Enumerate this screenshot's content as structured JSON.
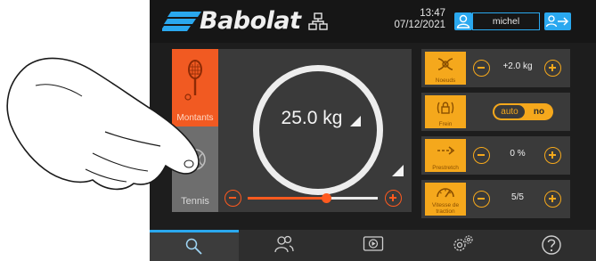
{
  "header": {
    "brand": "Babolat",
    "time": "13:47",
    "date": "07/12/2021",
    "user_name": "michel",
    "icons": {
      "network": "network-icon",
      "user": "user-icon",
      "logout": "logout-icon"
    }
  },
  "modes": [
    {
      "label": "Montants",
      "icon": "racket-icon",
      "selected": true
    },
    {
      "label": "Tennis",
      "icon": "tennis-ball-icon",
      "selected": false
    }
  ],
  "tension": {
    "value": "25.0 kg",
    "slider_fraction": 0.6
  },
  "settings": {
    "knots": {
      "label": "Noeuds",
      "value": "+2.0 kg",
      "icon": "knot-icon"
    },
    "brake": {
      "label": "Frein",
      "options": [
        "auto",
        "no"
      ],
      "selected": "no",
      "icon": "lock-icon"
    },
    "prestretch": {
      "label": "Prestretch",
      "value": "0 %",
      "icon": "stretch-arrow-icon"
    },
    "speed": {
      "label": "Vitesse de traction",
      "value": "5/5",
      "icon": "speed-gauge-icon"
    }
  },
  "nav": [
    {
      "name": "search",
      "icon": "search-icon",
      "active": true
    },
    {
      "name": "users",
      "icon": "users-icon",
      "active": false
    },
    {
      "name": "video",
      "icon": "play-icon",
      "active": false
    },
    {
      "name": "settings",
      "icon": "gears-icon",
      "active": false
    },
    {
      "name": "help",
      "icon": "help-icon",
      "active": false
    }
  ],
  "colors": {
    "accent_orange": "#f15a22",
    "accent_amber": "#f5a81c",
    "accent_blue": "#2aa8ef",
    "panel": "#3a3a3a",
    "background": "#1d1d1d"
  }
}
